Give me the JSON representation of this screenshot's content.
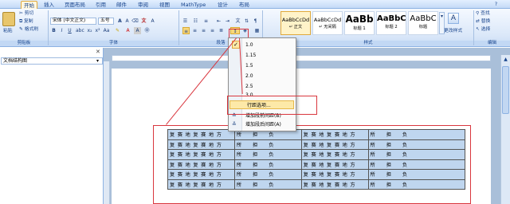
{
  "tabs": [
    "开始",
    "插入",
    "页面布局",
    "引用",
    "邮件",
    "审阅",
    "视图",
    "MathType",
    "设计",
    "布局"
  ],
  "clipboard": {
    "paste_label": "粘贴",
    "cut_label": "剪切",
    "copy_label": "复制",
    "format_painter_label": "格式刷",
    "group_label": "剪贴板"
  },
  "font": {
    "font_name": "宋体 (中文正文)",
    "font_size": "五号",
    "group_label": "字体"
  },
  "paragraph": {
    "group_label": "段落"
  },
  "styles": {
    "group_label": "样式",
    "cards": [
      {
        "sample": "AaBbCcDd",
        "name": "↵ 正文"
      },
      {
        "sample": "AaBbCcDd",
        "name": "↵ 无间隔"
      },
      {
        "sample": "AaBb",
        "name": "标题 1"
      },
      {
        "sample": "AaBbC",
        "name": "标题 2"
      },
      {
        "sample": "AaBbC",
        "name": "标题"
      }
    ],
    "change_styles_label": "更改样式"
  },
  "editing": {
    "find_label": "查找",
    "replace_label": "替换",
    "select_label": "选择",
    "group_label": "编辑"
  },
  "nav_pane": {
    "dropdown_value": "文档结构图"
  },
  "line_spacing_menu": {
    "items": [
      "1.0",
      "1.15",
      "1.5",
      "2.0",
      "2.5",
      "3.0"
    ],
    "checked": "1.0",
    "options_label": "行距选项...",
    "add_before_label": "增加段前间距(B)",
    "add_after_label": "增加段后间距(A)"
  },
  "table": {
    "rows": [
      [
        "复赛地复赛地方",
        "所担负",
        "复赛地复赛地方",
        "所担负"
      ],
      [
        "复赛地复赛地方",
        "所担负",
        "复赛地复赛地方",
        "所担负"
      ],
      [
        "复赛地复赛地方",
        "所担负",
        "复赛地复赛地方",
        "所担负"
      ],
      [
        "复赛地复赛地方",
        "所担负",
        "复赛地复赛地方",
        "所担负"
      ],
      [
        "复赛地复赛地方",
        "所担负",
        "复赛地复赛地方",
        "所担负"
      ],
      [
        "复赛地复赛地方",
        "所担负",
        "复赛地复赛地方",
        "所担负"
      ]
    ]
  },
  "colors": {
    "highlight_red": "#d9363e",
    "ribbon_blue": "#dbe8f9",
    "table_fill": "#bfd6ef",
    "menu_hover": "#fde9a8"
  }
}
